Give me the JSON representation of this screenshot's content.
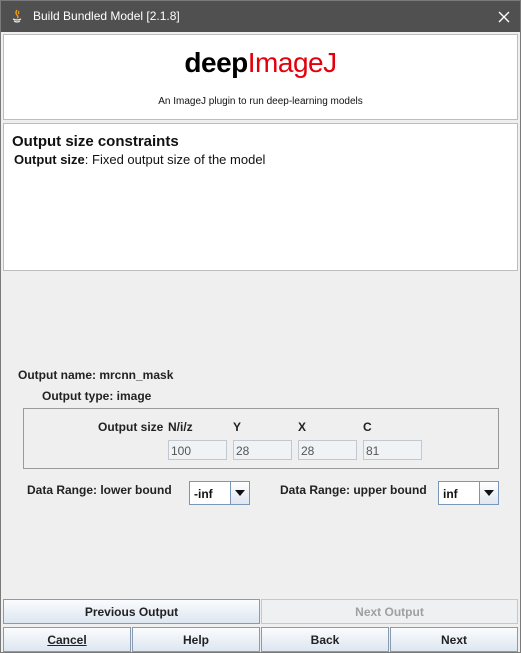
{
  "window": {
    "title": "Build Bundled Model [2.1.8]"
  },
  "header": {
    "logo_part1": "deep",
    "logo_part2": "ImageJ",
    "tagline": "An ImageJ plugin to run deep-learning models"
  },
  "info": {
    "heading": "Output size constraints",
    "desc_label": "Output size",
    "desc_text": ": Fixed output size of the model"
  },
  "output": {
    "name_label": "Output name: mrcnn_mask",
    "type_label": "Output type: image",
    "size_label": "Output size",
    "columns": [
      "N/i/z",
      "Y",
      "X",
      "C"
    ],
    "values": [
      "100",
      "28",
      "28",
      "81"
    ]
  },
  "range": {
    "lower_label": "Data Range: lower bound",
    "lower_value": "-inf",
    "upper_label": "Data Range: upper bound",
    "upper_value": "inf"
  },
  "nav": {
    "previous_output": "Previous Output",
    "next_output": "Next Output",
    "cancel": "Cancel",
    "help": "Help",
    "back": "Back",
    "next": "Next"
  },
  "colors": {
    "accent_red": "#e3000b",
    "titlebar": "#505050"
  }
}
